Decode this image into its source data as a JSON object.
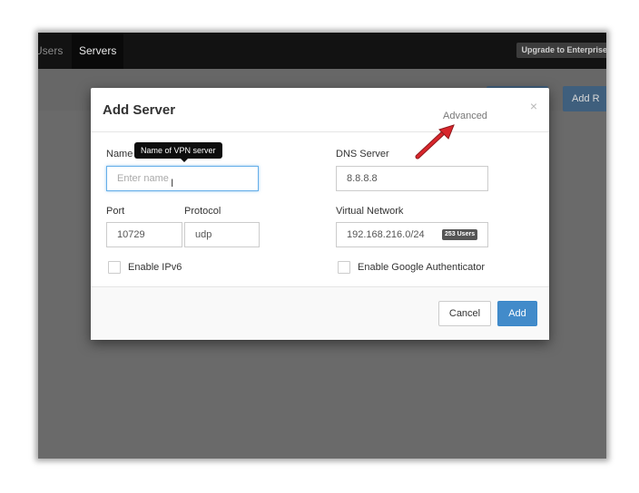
{
  "navbar": {
    "users_label": "Users",
    "servers_label": "Servers",
    "upgrade_label": "Upgrade to Enterprise"
  },
  "background": {
    "button_1_label": "",
    "button_2_label": "Add R"
  },
  "modal": {
    "title": "Add Server",
    "advanced_label": "Advanced",
    "close_glyph": "×",
    "name": {
      "label": "Name",
      "placeholder": "Enter name",
      "tooltip": "Name of VPN server"
    },
    "dns": {
      "label": "DNS Server",
      "value": "8.8.8.8"
    },
    "port": {
      "label": "Port",
      "value": "10729"
    },
    "protocol": {
      "label": "Protocol",
      "value": "udp"
    },
    "virtual_network": {
      "label": "Virtual Network",
      "value": "192.168.216.0/24",
      "users_badge": "253 Users"
    },
    "enable_ipv6": {
      "label": "Enable IPv6",
      "checked": false
    },
    "enable_google_auth": {
      "label": "Enable Google Authenticator",
      "checked": false
    },
    "cancel_label": "Cancel",
    "add_label": "Add"
  },
  "colors": {
    "primary": "#428bca",
    "overlay": "#676767",
    "arrow": "#d9262c"
  }
}
